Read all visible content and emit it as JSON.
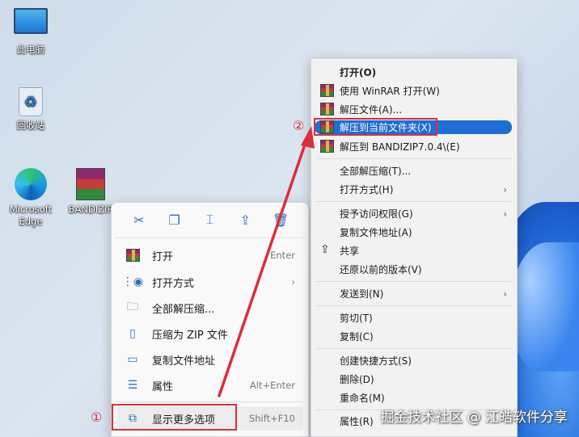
{
  "desktop": {
    "icons": [
      {
        "label": "此电脑"
      },
      {
        "label": "回收站"
      },
      {
        "label": "Microsoft Edge"
      },
      {
        "label": "BANDIZIP"
      }
    ]
  },
  "left_menu": {
    "toolbar": [
      "cut-icon",
      "copy-icon",
      "rename-icon",
      "share-icon",
      "delete-icon"
    ],
    "items": [
      {
        "label": "打开",
        "shortcut": "Enter"
      },
      {
        "label": "打开方式",
        "submenu": true
      },
      {
        "label": "全部解压缩..."
      },
      {
        "label": "压缩为 ZIP 文件"
      },
      {
        "label": "复制文件地址"
      },
      {
        "label": "属性",
        "shortcut": "Alt+Enter"
      },
      {
        "label": "显示更多选项",
        "shortcut": "Shift+F10"
      }
    ]
  },
  "right_menu": {
    "items": [
      {
        "label": "打开(O)"
      },
      {
        "label": "使用 WinRAR 打开(W)"
      },
      {
        "label": "解压文件(A)..."
      },
      {
        "label": "解压到当前文件夹(X)"
      },
      {
        "label": "解压到 BANDIZIP7.0.4\\(E)"
      },
      {
        "label": "全部解压缩(T)..."
      },
      {
        "label": "打开方式(H)"
      },
      {
        "label": "授予访问权限(G)"
      },
      {
        "label": "复制文件地址(A)"
      },
      {
        "label": "共享"
      },
      {
        "label": "还原以前的版本(V)"
      },
      {
        "label": "发送到(N)"
      },
      {
        "label": "剪切(T)"
      },
      {
        "label": "复制(C)"
      },
      {
        "label": "创建快捷方式(S)"
      },
      {
        "label": "删除(D)"
      },
      {
        "label": "重命名(M)"
      },
      {
        "label": "属性(R)"
      }
    ]
  },
  "annotations": {
    "step1": "①",
    "step2": "②",
    "color": "#d9303a"
  },
  "watermark": "掘金技术社区 @ 江皓软件分享"
}
